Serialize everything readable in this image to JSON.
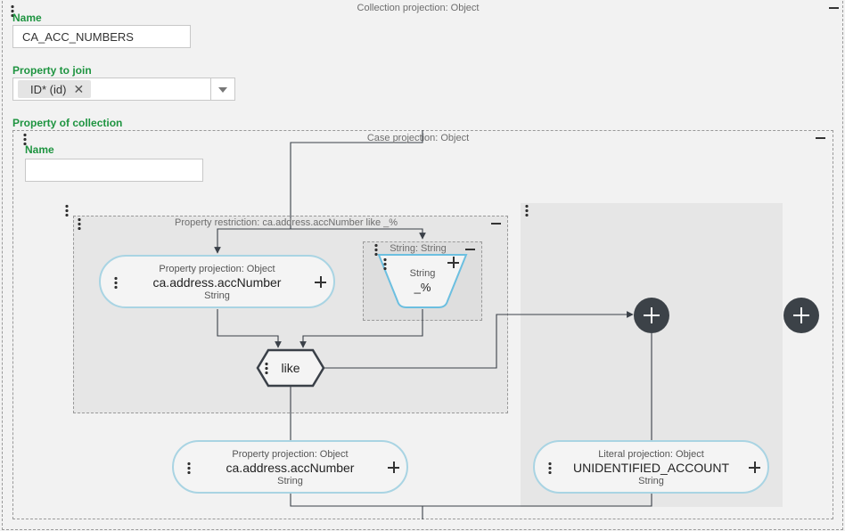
{
  "collection": {
    "caption": "Collection projection: Object",
    "name_label": "Name",
    "name_value": "CA_ACC_NUMBERS",
    "join_label": "Property to join",
    "join_chip": "ID* (id)",
    "join_chip_remove": "✕",
    "collection_label": "Property of collection"
  },
  "case_projection": {
    "caption": "Case projection: Object",
    "name_label": "Name",
    "name_value": ""
  },
  "restriction": {
    "caption": "Property restriction: ca.address.accNumber like _%"
  },
  "property_projection_inner": {
    "caption": "Property projection: Object",
    "value": "ca.address.accNumber",
    "type": "String"
  },
  "string_group": {
    "caption": "String: String"
  },
  "string_literal": {
    "type": "String",
    "value": "_%"
  },
  "like_node": {
    "label": "like"
  },
  "property_projection_outer": {
    "caption": "Property projection: Object",
    "value": "ca.address.accNumber",
    "type": "String"
  },
  "literal_projection": {
    "caption": "Literal projection: Object",
    "value": "UNIDENTIFIED_ACCOUNT",
    "type": "String"
  },
  "colors": {
    "green": "#1e9440",
    "pill_border": "#a9d4e3",
    "dark_node": "#3c4248",
    "connector": "#3a4048"
  }
}
